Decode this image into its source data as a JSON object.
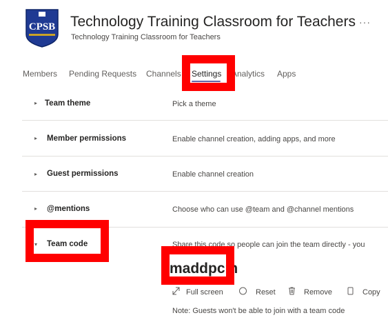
{
  "header": {
    "logo_text": "CPSB",
    "title": "Technology Training Classroom for Teachers",
    "subtitle": "Technology Training Classroom for Teachers",
    "more_label": "···"
  },
  "tabs": [
    {
      "label": "Members"
    },
    {
      "label": "Pending Requests"
    },
    {
      "label": "Channels"
    },
    {
      "label": "Settings",
      "active": true
    },
    {
      "label": "Analytics"
    },
    {
      "label": "Apps"
    }
  ],
  "settings": [
    {
      "label": "Team theme",
      "description": "Pick a theme",
      "expanded": false
    },
    {
      "label": "Member permissions",
      "description": "Enable channel creation, adding apps, and more",
      "expanded": false
    },
    {
      "label": "Guest permissions",
      "description": "Enable channel creation",
      "expanded": false
    },
    {
      "label": "@mentions",
      "description": "Choose who can use @team and @channel mentions",
      "expanded": false
    },
    {
      "label": "Team code",
      "description": "Share this code so people can join the team directly - you",
      "expanded": true
    }
  ],
  "team_code": {
    "code": "maddpcm",
    "actions": [
      "Full screen",
      "Reset",
      "Remove",
      "Copy"
    ],
    "note": "Note: Guests won't be able to join with a team code"
  },
  "colors": {
    "accent": "#6264a7",
    "annotation": "#ff0000"
  }
}
